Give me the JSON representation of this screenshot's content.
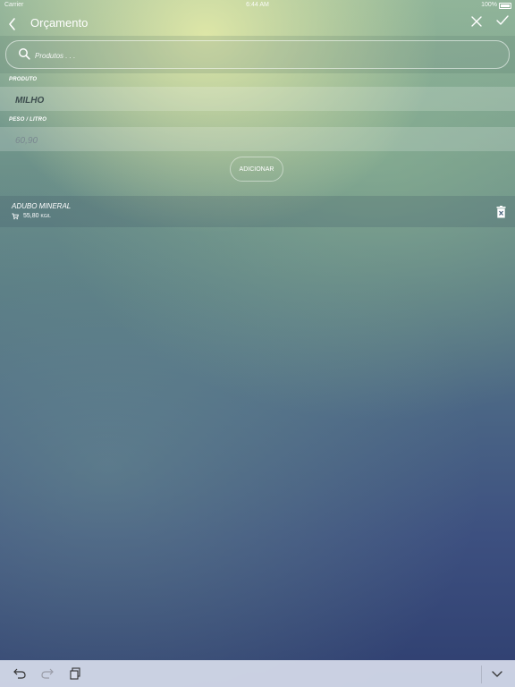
{
  "status": {
    "carrier": "Carrier",
    "time": "6:44 AM",
    "battery": "100%"
  },
  "nav": {
    "title": "Orçamento"
  },
  "search": {
    "placeholder": "Produtos . . ."
  },
  "form": {
    "product_label": "PRODUTO",
    "product_value": "MILHO",
    "weight_label": "PESO / LITRO",
    "weight_value": "60,90",
    "add_button": "ADICIONAR"
  },
  "items": [
    {
      "name": "ADUBO MINERAL",
      "value": "55,80",
      "unit": "KG/L"
    }
  ],
  "icons": {
    "back": "chevron-left-icon",
    "close": "close-icon",
    "confirm": "checkmark-icon",
    "search": "search-icon",
    "cart": "cart-icon",
    "delete": "trash-icon",
    "undo": "undo-icon",
    "redo": "redo-icon",
    "paste": "paste-icon",
    "dismiss_keyboard": "chevron-down-icon"
  }
}
